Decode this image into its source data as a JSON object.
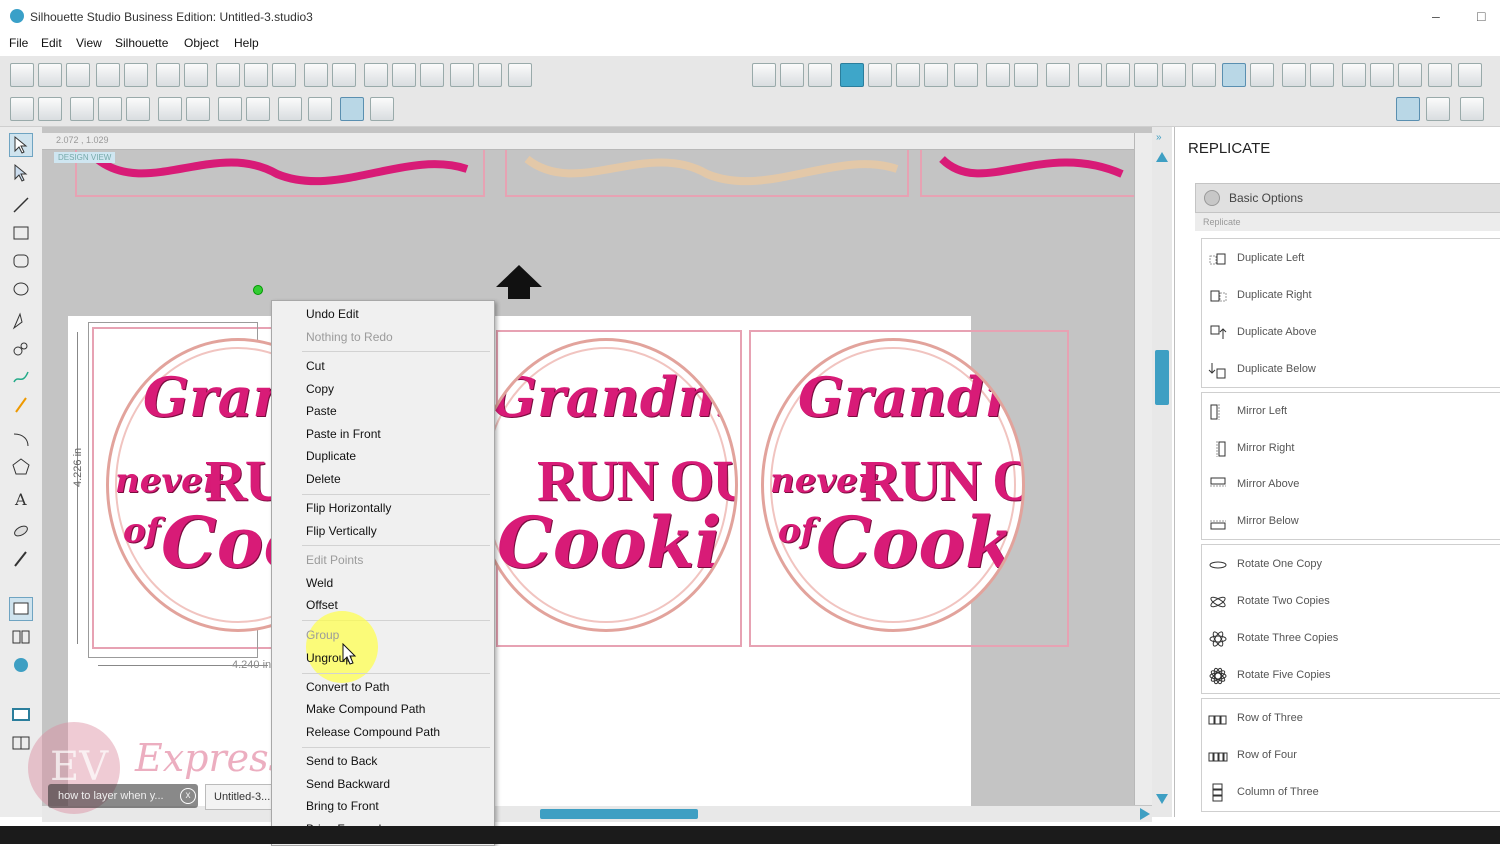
{
  "window": {
    "title": "Silhouette Studio Business Edition: Untitled-3.studio3",
    "minimize_glyph": "–",
    "maximize_glyph": "□"
  },
  "menu": [
    "File",
    "Edit",
    "View",
    "Silhouette",
    "Object",
    "Help"
  ],
  "canvas": {
    "ruler_readout": "2.072 , 1.029",
    "design_view_label": "DESIGN VIEW",
    "height_dim": "4.226 in",
    "width_dim": "4.240 in",
    "badge": {
      "line1": "Grandmas",
      "line2_script": "never",
      "line2_block": "RUN OUT",
      "line3_script": "of",
      "line3": "Cookies"
    }
  },
  "context_menu": {
    "items": [
      {
        "label": "Undo Edit",
        "disabled": false
      },
      {
        "label": "Nothing to Redo",
        "disabled": true
      },
      {
        "label": "Cut",
        "disabled": false
      },
      {
        "label": "Copy",
        "disabled": false
      },
      {
        "label": "Paste",
        "disabled": false
      },
      {
        "label": "Paste in Front",
        "disabled": false
      },
      {
        "label": "Duplicate",
        "disabled": false
      },
      {
        "label": "Delete",
        "disabled": false
      },
      {
        "label": "Flip Horizontally",
        "disabled": false
      },
      {
        "label": "Flip Vertically",
        "disabled": false
      },
      {
        "label": "Edit Points",
        "disabled": true
      },
      {
        "label": "Weld",
        "disabled": false
      },
      {
        "label": "Offset",
        "disabled": false
      },
      {
        "label": "Group",
        "disabled": true
      },
      {
        "label": "Ungroup",
        "disabled": false
      },
      {
        "label": "Convert to Path",
        "disabled": false
      },
      {
        "label": "Make Compound Path",
        "disabled": false
      },
      {
        "label": "Release Compound Path",
        "disabled": false
      },
      {
        "label": "Send to Back",
        "disabled": false
      },
      {
        "label": "Send Backward",
        "disabled": false
      },
      {
        "label": "Bring to Front",
        "disabled": false
      },
      {
        "label": "Bring Forward",
        "disabled": false
      }
    ]
  },
  "panel": {
    "title": "REPLICATE",
    "section": "Basic Options",
    "subsection": "Replicate",
    "items": [
      "Duplicate Left",
      "Duplicate Right",
      "Duplicate Above",
      "Duplicate Below",
      "Mirror Left",
      "Mirror Right",
      "Mirror Above",
      "Mirror Below",
      "Rotate One Copy",
      "Rotate Two Copies",
      "Rotate Three Copies",
      "Rotate Five Copies",
      "Row of Three",
      "Row of Four",
      "Column of Three"
    ]
  },
  "watermark": {
    "text": "Expressions Vinyl",
    "logo_letters": "EV"
  },
  "taskbar": {
    "tab1": "how to layer when y...",
    "tab2": "Untitled-3..."
  },
  "colors": {
    "accent_blue": "#3e9fc3",
    "badge_pink": "#d81b77",
    "frame_pink": "#e7a2b3",
    "highlight_yellow": "#ffff46"
  }
}
